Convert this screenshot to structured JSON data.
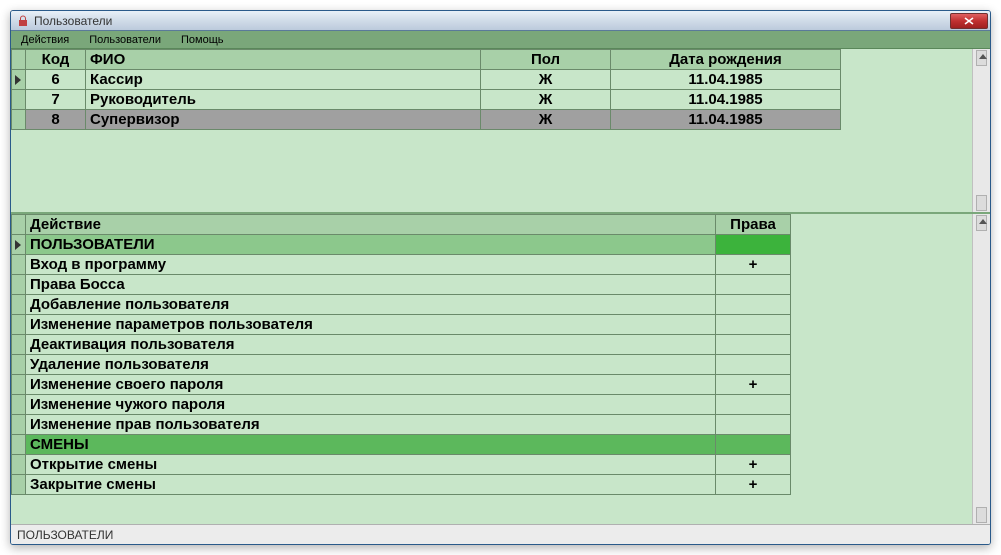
{
  "window": {
    "title": "Пользователи"
  },
  "menubar": {
    "items": [
      "Действия",
      "Пользователи",
      "Помощь"
    ]
  },
  "users": {
    "columns": {
      "code": "Код",
      "name": "ФИО",
      "sex": "Пол",
      "dob": "Дата рождения"
    },
    "rows": [
      {
        "code": "6",
        "name": "Кассир",
        "sex": "Ж",
        "dob": "11.04.1985",
        "selected": false,
        "active": true
      },
      {
        "code": "7",
        "name": "Руководитель",
        "sex": "Ж",
        "dob": "11.04.1985",
        "selected": false,
        "active": false
      },
      {
        "code": "8",
        "name": "Супервизор",
        "sex": "Ж",
        "dob": "11.04.1985",
        "selected": true,
        "active": false
      }
    ]
  },
  "rights": {
    "columns": {
      "action": "Действие",
      "right": "Права"
    },
    "rows": [
      {
        "label": "ПОЛЬЗОВАТЕЛИ",
        "right": "",
        "section": true,
        "first": true,
        "active": true
      },
      {
        "label": "Вход в программу",
        "right": "+",
        "section": false
      },
      {
        "label": "Права Босса",
        "right": "",
        "section": false
      },
      {
        "label": "Добавление пользователя",
        "right": "",
        "section": false
      },
      {
        "label": "Изменение параметров пользователя",
        "right": "",
        "section": false
      },
      {
        "label": "Деактивация пользователя",
        "right": "",
        "section": false
      },
      {
        "label": "Удаление пользователя",
        "right": "",
        "section": false
      },
      {
        "label": "Изменение своего пароля",
        "right": "+",
        "section": false
      },
      {
        "label": "Изменение чужого пароля",
        "right": "",
        "section": false
      },
      {
        "label": "Изменение прав пользователя",
        "right": "",
        "section": false
      },
      {
        "label": "СМЕНЫ",
        "right": "",
        "section": true
      },
      {
        "label": "Открытие смены",
        "right": "+",
        "section": false
      },
      {
        "label": "Закрытие смены",
        "right": "+",
        "section": false
      }
    ]
  },
  "statusbar": {
    "text": "ПОЛЬЗОВАТЕЛИ"
  },
  "colors": {
    "accent": "#5cb85c",
    "grid_bg": "#c8e6c9",
    "header_bg": "#a8d0a8",
    "selected_row": "#a0a0a0"
  }
}
